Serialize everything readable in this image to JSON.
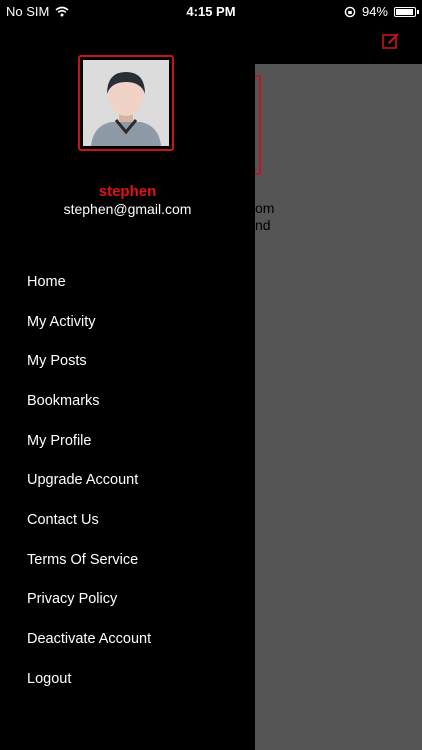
{
  "status_bar": {
    "carrier": "No SIM",
    "time": "4:15 PM",
    "battery_percent": "94%",
    "battery_level": 0.94
  },
  "background_screen": {
    "text_line1": "om",
    "text_line2": "nd",
    "accent_color": "#c3151c"
  },
  "drawer": {
    "user_name": "stephen",
    "user_email": "stephen@gmail.com",
    "menu_items": [
      {
        "label": "Home"
      },
      {
        "label": "My Activity"
      },
      {
        "label": "My Posts"
      },
      {
        "label": "Bookmarks"
      },
      {
        "label": "My Profile"
      },
      {
        "label": "Upgrade Account"
      },
      {
        "label": "Contact Us"
      },
      {
        "label": "Terms Of Service"
      },
      {
        "label": "Privacy Policy"
      },
      {
        "label": "Deactivate Account"
      },
      {
        "label": "Logout"
      }
    ]
  },
  "colors": {
    "accent": "#e0131a",
    "drawer_bg": "#000000",
    "overlay_bg": "#555555"
  }
}
